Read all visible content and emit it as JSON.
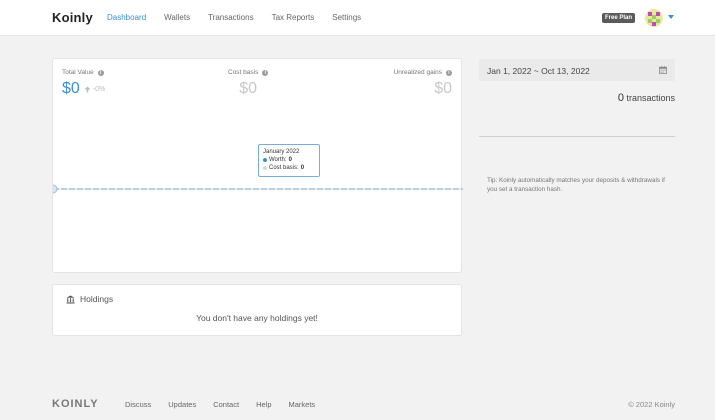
{
  "header": {
    "logo": "Koinly",
    "nav": [
      {
        "label": "Dashboard",
        "active": true
      },
      {
        "label": "Wallets",
        "active": false
      },
      {
        "label": "Transactions",
        "active": false
      },
      {
        "label": "Tax Reports",
        "active": false
      },
      {
        "label": "Settings",
        "active": false
      }
    ],
    "plan_badge": "Free Plan",
    "accent_color": "#3c8dd9"
  },
  "summary": {
    "total_value": {
      "label": "Total Value",
      "value": "$0",
      "change": "-0%"
    },
    "cost_basis": {
      "label": "Cost basis",
      "value": "$0"
    },
    "unrealized_gains": {
      "label": "Unrealized gains",
      "value": "$0"
    }
  },
  "chart_data": {
    "type": "line",
    "x": [
      "January 2022"
    ],
    "series": [
      {
        "name": "Worth",
        "values": [
          0
        ],
        "color": "#3c8dd9"
      },
      {
        "name": "Cost basis",
        "values": [
          0
        ],
        "color": "#d8d8d8"
      }
    ],
    "tooltip": {
      "title": "January 2022",
      "worth_label": "Worth:",
      "worth_value": "0",
      "cost_label": "Cost basis:",
      "cost_value": "0"
    }
  },
  "holdings": {
    "title": "Holdings",
    "empty_message": "You don't have any holdings yet!"
  },
  "sidebar": {
    "date_range": "Jan 1, 2022 ~ Oct 13, 2022",
    "transactions_count": "0",
    "transactions_label": "transactions",
    "tip": "Tip: Koinly automatically matches your deposits & withdrawals if you set a transaction hash."
  },
  "footer": {
    "logo": "KOINLY",
    "links": [
      "Discuss",
      "Updates",
      "Contact",
      "Help",
      "Markets"
    ],
    "copyright": "© 2022 Koinly"
  }
}
